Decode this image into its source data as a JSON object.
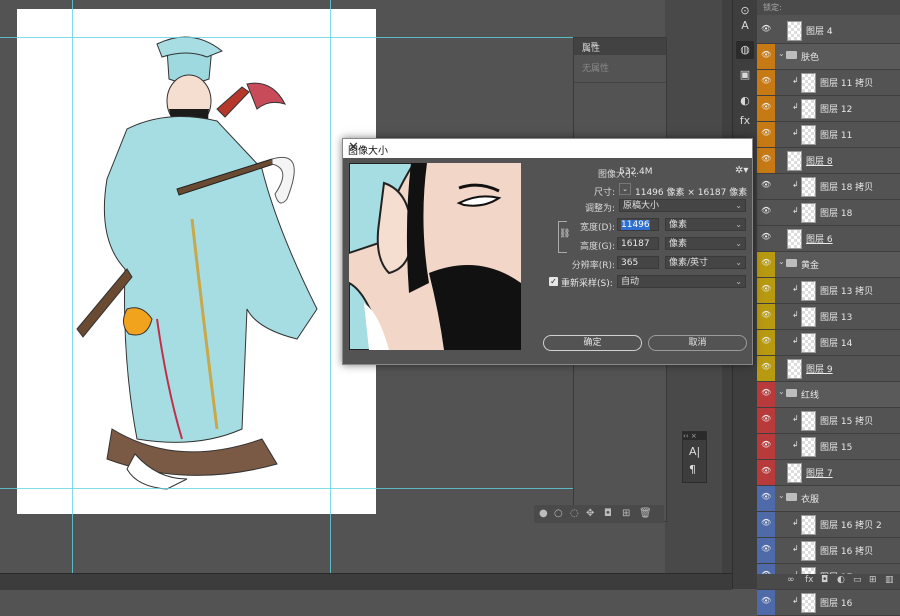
{
  "dialog": {
    "title": "图像大小",
    "image_size_label": "图像大小:",
    "image_size_value": "532.4M",
    "dimensions_label": "尺寸:",
    "dimensions_value": "11496 像素 × 16187 像素",
    "fit_to_label": "调整为:",
    "fit_to_value": "原稿大小",
    "width_label": "宽度(D):",
    "width_value": "11496",
    "width_unit": "像素",
    "height_label": "高度(G):",
    "height_value": "16187",
    "height_unit": "像素",
    "resolution_label": "分辨率(R):",
    "resolution_value": "365",
    "resolution_unit": "像素/英寸",
    "resample_label": "重新采样(S):",
    "resample_value": "自动",
    "resample_checked": true,
    "ok_label": "确定",
    "cancel_label": "取消"
  },
  "properties": {
    "tab": "属性",
    "empty_text": "无属性"
  },
  "layers": {
    "lock_label": "锁定:",
    "items": [
      {
        "name": "图层 4",
        "kind": "layer",
        "color": "",
        "underline": false
      },
      {
        "name": "肤色",
        "kind": "group",
        "color": "#c77a14",
        "underline": false
      },
      {
        "name": "图层 11 拷贝",
        "kind": "clip",
        "color": "#c77a14",
        "underline": false
      },
      {
        "name": "图层 12",
        "kind": "clip",
        "color": "#c77a14",
        "underline": false
      },
      {
        "name": "图层 11",
        "kind": "clip",
        "color": "#c77a14",
        "underline": false
      },
      {
        "name": "图层 8",
        "kind": "layer",
        "color": "#c77a14",
        "underline": true
      },
      {
        "name": "图层 18 拷贝",
        "kind": "clip",
        "color": "",
        "underline": false
      },
      {
        "name": "图层 18",
        "kind": "clip",
        "color": "",
        "underline": false
      },
      {
        "name": "图层 6",
        "kind": "layer",
        "color": "",
        "underline": true
      },
      {
        "name": "黄金",
        "kind": "group",
        "color": "#b89a10",
        "underline": false
      },
      {
        "name": "图层 13 拷贝",
        "kind": "clip",
        "color": "#b89a10",
        "underline": false
      },
      {
        "name": "图层 13",
        "kind": "clip",
        "color": "#b89a10",
        "underline": false
      },
      {
        "name": "图层 14",
        "kind": "clip",
        "color": "#b89a10",
        "underline": false
      },
      {
        "name": "图层 9",
        "kind": "layer",
        "color": "#b89a10",
        "underline": true
      },
      {
        "name": "红线",
        "kind": "group",
        "color": "#b83a3a",
        "underline": false
      },
      {
        "name": "图层 15 拷贝",
        "kind": "clip",
        "color": "#b83a3a",
        "underline": false
      },
      {
        "name": "图层 15",
        "kind": "clip",
        "color": "#b83a3a",
        "underline": false
      },
      {
        "name": "图层 7",
        "kind": "layer",
        "color": "#b83a3a",
        "underline": true
      },
      {
        "name": "衣服",
        "kind": "group",
        "color": "#4e6aa8",
        "underline": false
      },
      {
        "name": "图层 16 拷贝 2",
        "kind": "clip",
        "color": "#4e6aa8",
        "underline": false
      },
      {
        "name": "图层 16 拷贝",
        "kind": "clip",
        "color": "#4e6aa8",
        "underline": false
      },
      {
        "name": "图层 17",
        "kind": "clip",
        "color": "#4e6aa8",
        "underline": false
      },
      {
        "name": "图层 16",
        "kind": "clip",
        "color": "#4e6aa8",
        "underline": false
      }
    ]
  },
  "icons": {
    "visibility": "eye-icon",
    "folder": "folder-icon",
    "clip": "clipping-mask-icon",
    "settings": "gear-icon",
    "link": "chain-link-icon"
  }
}
